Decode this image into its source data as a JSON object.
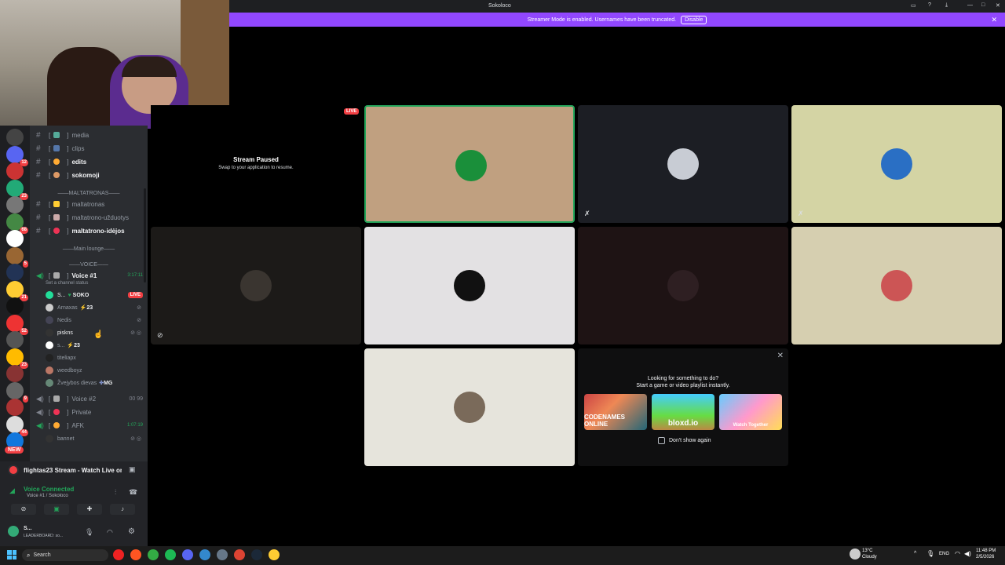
{
  "window": {
    "title": "Sokoloco"
  },
  "banner": {
    "text": "Streamer Mode is enabled. Usernames have been truncated.",
    "disable_label": "Disable"
  },
  "sidebar": {
    "channels": [
      {
        "name": "media",
        "bold": false
      },
      {
        "name": "clips",
        "bold": false
      },
      {
        "name": "edits",
        "bold": true
      },
      {
        "name": "sokomoji",
        "bold": true
      }
    ],
    "category1": "MALTATRONAS",
    "channels2": [
      {
        "name": "maltatronas",
        "bold": false
      },
      {
        "name": "maltatrono-užduotys",
        "bold": false
      },
      {
        "name": "maltatrono-idėjos",
        "bold": true
      }
    ],
    "category2": "Main lounge",
    "category3": "VOICE",
    "voice1": {
      "name": "Voice #1",
      "timer": "3:17:11",
      "status": "Set a channel status"
    },
    "users": [
      {
        "name": "S...",
        "tag": "SOKO",
        "live": "LIVE"
      },
      {
        "name": "Arnaxas",
        "tag": "23"
      },
      {
        "name": "Nedis",
        "tag": ""
      },
      {
        "name": "piskns",
        "tag": ""
      },
      {
        "name": "s...",
        "tag": "23"
      },
      {
        "name": "titeliapx",
        "tag": ""
      },
      {
        "name": "weedboyz",
        "tag": ""
      },
      {
        "name": "Žvejybos dievas",
        "tag": "MG"
      }
    ],
    "voice2": {
      "name": "Voice #2",
      "counter": "00 99"
    },
    "private": {
      "name": "Private"
    },
    "afk": {
      "name": "AFK",
      "timer": "1:07:19"
    },
    "afk_user": "bannet",
    "server_badges": [
      "12",
      "23",
      "68",
      "5",
      "21",
      "52",
      "23",
      "9",
      "44",
      "162",
      "16",
      "92",
      "36",
      "78",
      "44"
    ],
    "new_label": "NEW"
  },
  "panel": {
    "stream_title": "flightas23 Stream - Watch Live on ...",
    "voice_status": "Voice Connected",
    "voice_channel": "Voice #1 / Sokoloco",
    "user_name": "S...",
    "user_status": "LEADERBOARD: so..."
  },
  "stream": {
    "live_badge": "LIVE",
    "paused_title": "Stream Paused",
    "paused_sub": "Swap to your application to resume."
  },
  "activity": {
    "title": "Looking for something to do?",
    "subtitle": "Start a game or video playlist instantly.",
    "games": [
      "CODENAMES ONLINE",
      "bloxd.io",
      "Watch Together"
    ],
    "checkbox_label": "Don't show again"
  },
  "taskbar": {
    "search_placeholder": "Search",
    "weather_temp": "13°C",
    "weather_desc": "Cloudy",
    "lang": "ENG",
    "time": "11:48 PM",
    "date": "2/5/2026"
  },
  "colors": {
    "accent": "#9147ff",
    "live": "#f23f43",
    "speaking": "#23a55a"
  }
}
